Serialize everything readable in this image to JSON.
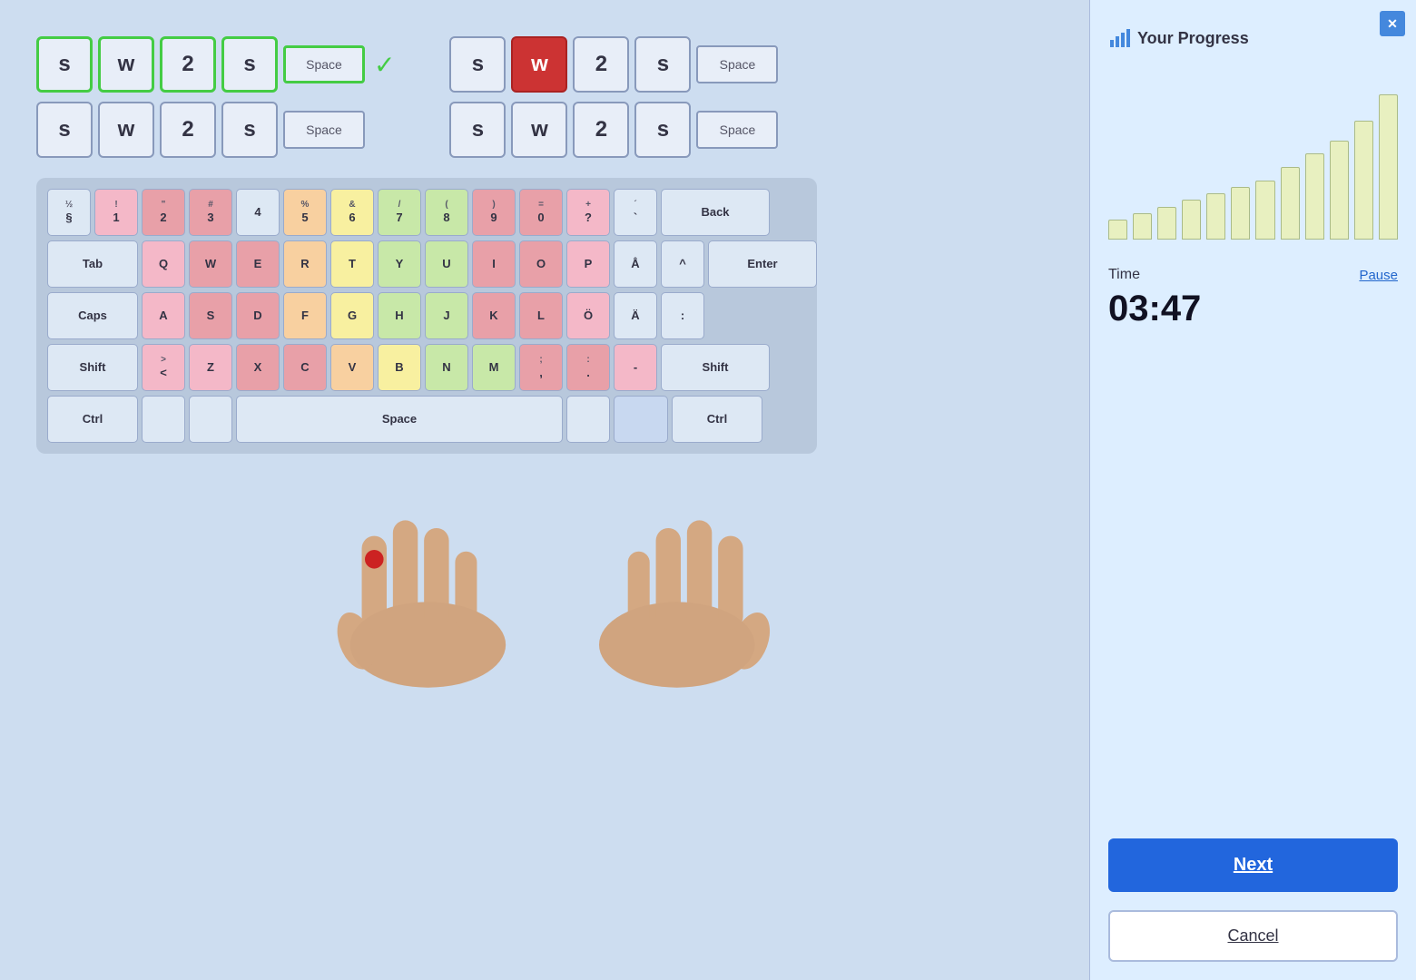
{
  "exercise": {
    "rows": [
      {
        "id": "row1-completed",
        "keys": [
          "s",
          "w",
          "2",
          "s"
        ],
        "space_label": "Space",
        "completed": true,
        "style": "green"
      },
      {
        "id": "row1-normal",
        "keys": [
          "s",
          "w",
          "2",
          "s"
        ],
        "space_label": "Space",
        "completed": false,
        "style": "normal"
      }
    ],
    "active_row": {
      "keys_left": [
        "s"
      ],
      "active_key": "w",
      "keys_right": [
        "2",
        "s"
      ],
      "space_label": "Space"
    },
    "next_row": {
      "keys": [
        "s",
        "w",
        "2",
        "s"
      ],
      "space_label": "Space"
    }
  },
  "sidebar": {
    "title": "Your Progress",
    "close_label": "✕",
    "chart_bars": [
      3,
      4,
      5,
      6,
      7,
      8,
      9,
      11,
      13,
      15,
      18,
      22
    ],
    "time_label": "Time",
    "pause_label": "Pause",
    "time_value": "03:47",
    "next_label": "Next",
    "cancel_label": "Cancel"
  },
  "keyboard": {
    "rows": [
      {
        "keys": [
          {
            "label": "½\n§",
            "color": "key-default",
            "width": ""
          },
          {
            "label": "1\n!",
            "color": "key-pink",
            "width": ""
          },
          {
            "label": "2\n\"",
            "color": "key-red",
            "width": ""
          },
          {
            "label": "3\n#",
            "color": "key-red",
            "width": ""
          },
          {
            "label": "4",
            "color": "key-default",
            "width": ""
          },
          {
            "label": "5\n%",
            "color": "key-orange",
            "width": ""
          },
          {
            "label": "6\n&",
            "color": "key-yellow",
            "width": ""
          },
          {
            "label": "7\n/",
            "color": "key-green",
            "width": ""
          },
          {
            "label": "8\n(",
            "color": "key-green",
            "width": ""
          },
          {
            "label": "9\n)",
            "color": "key-red",
            "width": ""
          },
          {
            "label": "0\n=",
            "color": "key-red",
            "width": ""
          },
          {
            "label": "?\n+",
            "color": "key-pink",
            "width": ""
          },
          {
            "label": "`\n´",
            "color": "key-default",
            "width": ""
          },
          {
            "label": "Back",
            "color": "key-default",
            "width": "key-widest"
          }
        ]
      },
      {
        "keys": [
          {
            "label": "Tab",
            "color": "key-default",
            "width": "key-wider"
          },
          {
            "label": "Q",
            "color": "key-pink",
            "width": ""
          },
          {
            "label": "W",
            "color": "key-red",
            "width": ""
          },
          {
            "label": "E",
            "color": "key-red",
            "width": ""
          },
          {
            "label": "R",
            "color": "key-orange",
            "width": ""
          },
          {
            "label": "T",
            "color": "key-yellow",
            "width": ""
          },
          {
            "label": "Y",
            "color": "key-green",
            "width": ""
          },
          {
            "label": "U",
            "color": "key-green",
            "width": ""
          },
          {
            "label": "I",
            "color": "key-red",
            "width": ""
          },
          {
            "label": "O",
            "color": "key-red",
            "width": ""
          },
          {
            "label": "P",
            "color": "key-pink",
            "width": ""
          },
          {
            "label": "Å",
            "color": "key-default",
            "width": ""
          },
          {
            "label": "^",
            "color": "key-default",
            "width": ""
          },
          {
            "label": "Enter",
            "color": "key-default",
            "width": "key-widest"
          }
        ]
      },
      {
        "keys": [
          {
            "label": "Caps",
            "color": "key-default",
            "width": "key-wider"
          },
          {
            "label": "A",
            "color": "key-pink",
            "width": ""
          },
          {
            "label": "S",
            "color": "key-red",
            "width": ""
          },
          {
            "label": "D",
            "color": "key-red",
            "width": ""
          },
          {
            "label": "F",
            "color": "key-orange",
            "width": ""
          },
          {
            "label": "G",
            "color": "key-yellow",
            "width": ""
          },
          {
            "label": "H",
            "color": "key-green",
            "width": ""
          },
          {
            "label": "J",
            "color": "key-green",
            "width": ""
          },
          {
            "label": "K",
            "color": "key-red",
            "width": ""
          },
          {
            "label": "L",
            "color": "key-red",
            "width": ""
          },
          {
            "label": "Ö",
            "color": "key-pink",
            "width": ""
          },
          {
            "label": "Ä",
            "color": "key-default",
            "width": ""
          },
          {
            "label": "'",
            "color": "key-default",
            "width": ""
          }
        ]
      },
      {
        "keys": [
          {
            "label": "Shift",
            "color": "key-default",
            "width": "key-wider"
          },
          {
            "label": ">\n<",
            "color": "key-pink",
            "width": ""
          },
          {
            "label": "Z",
            "color": "key-pink",
            "width": ""
          },
          {
            "label": "X",
            "color": "key-red",
            "width": ""
          },
          {
            "label": "C",
            "color": "key-red",
            "width": ""
          },
          {
            "label": "V",
            "color": "key-orange",
            "width": ""
          },
          {
            "label": "B",
            "color": "key-yellow",
            "width": ""
          },
          {
            "label": "N",
            "color": "key-green",
            "width": ""
          },
          {
            "label": "M",
            "color": "key-green",
            "width": ""
          },
          {
            "label": ";\n,",
            "color": "key-red",
            "width": ""
          },
          {
            "label": ":\n.",
            "color": "key-red",
            "width": ""
          },
          {
            "label": "-",
            "color": "key-pink",
            "width": ""
          },
          {
            "label": "Shift",
            "color": "key-default",
            "width": "key-widest"
          }
        ]
      },
      {
        "keys": [
          {
            "label": "Ctrl",
            "color": "key-default",
            "width": "key-wider"
          },
          {
            "label": "",
            "color": "key-default",
            "width": ""
          },
          {
            "label": "",
            "color": "key-default",
            "width": ""
          },
          {
            "label": "Space",
            "color": "key-default",
            "width": "key-space"
          },
          {
            "label": "",
            "color": "key-default",
            "width": ""
          },
          {
            "label": "",
            "color": "key-default",
            "width": "key-lightblue"
          },
          {
            "label": "Ctrl",
            "color": "key-default",
            "width": "key-wider"
          }
        ]
      }
    ]
  }
}
